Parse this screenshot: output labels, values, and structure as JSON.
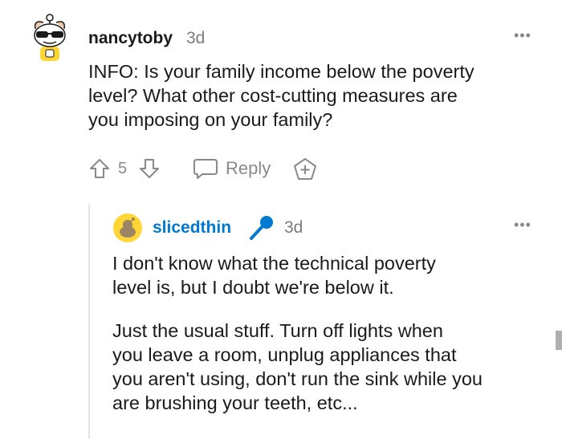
{
  "comment": {
    "username": "nancytoby",
    "timestamp": "3d",
    "more_icon": "more-dots-icon",
    "text_lines": [
      "INFO: Is your family income below the poverty",
      "level? What other cost-cutting measures are",
      "you imposing on your family?"
    ],
    "actions": {
      "upvote_icon": "upvote-arrow-icon",
      "score": "5",
      "downvote_icon": "downvote-arrow-icon",
      "reply_icon": "speech-bubble-icon",
      "reply_label": "Reply",
      "award_icon": "add-award-icon"
    }
  },
  "reply": {
    "username": "slicedthin",
    "username_color": "#0079d3",
    "flair_icon": "microphone-icon",
    "timestamp": "3d",
    "more_icon": "more-dots-icon",
    "paragraph1_lines": [
      "I don't know what the technical poverty",
      "level is, but I doubt we're below it."
    ],
    "paragraph2_lines": [
      "Just the usual stuff. Turn off lights when",
      "you leave a room, unplug appliances that",
      "you aren't using, don't run the sink while you",
      "are brushing your teeth, etc..."
    ]
  },
  "colors": {
    "meta_gray": "#878a8c",
    "accent_blue": "#0079d3",
    "thread_line": "#e5e5e5"
  }
}
